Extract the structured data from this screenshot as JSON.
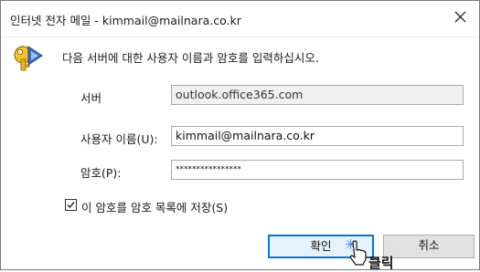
{
  "window": {
    "title": "인터넷 전자 메일 - kimmail@mailnara.co.kr",
    "close_glyph": "✕"
  },
  "prompt": "다음 서버에 대한 사용자 이름과 암호를 입력하십시오.",
  "form": {
    "server": {
      "label": "서버",
      "value": "outlook.office365.com"
    },
    "username": {
      "label": "사용자 이름(U):",
      "value": "kimmail@mailnara.co.kr"
    },
    "password": {
      "label": "암호(P):",
      "value": "****************"
    },
    "remember": {
      "label": "이 암호를 암호 목록에 저장(S)",
      "checked": true
    }
  },
  "buttons": {
    "ok": "확인",
    "cancel": "취소"
  },
  "annotation": {
    "star": "✳",
    "text": "클릭"
  },
  "colors": {
    "accent": "#0078d7",
    "key_gold": "#d9a400",
    "key_blue": "#3d6fc4"
  }
}
